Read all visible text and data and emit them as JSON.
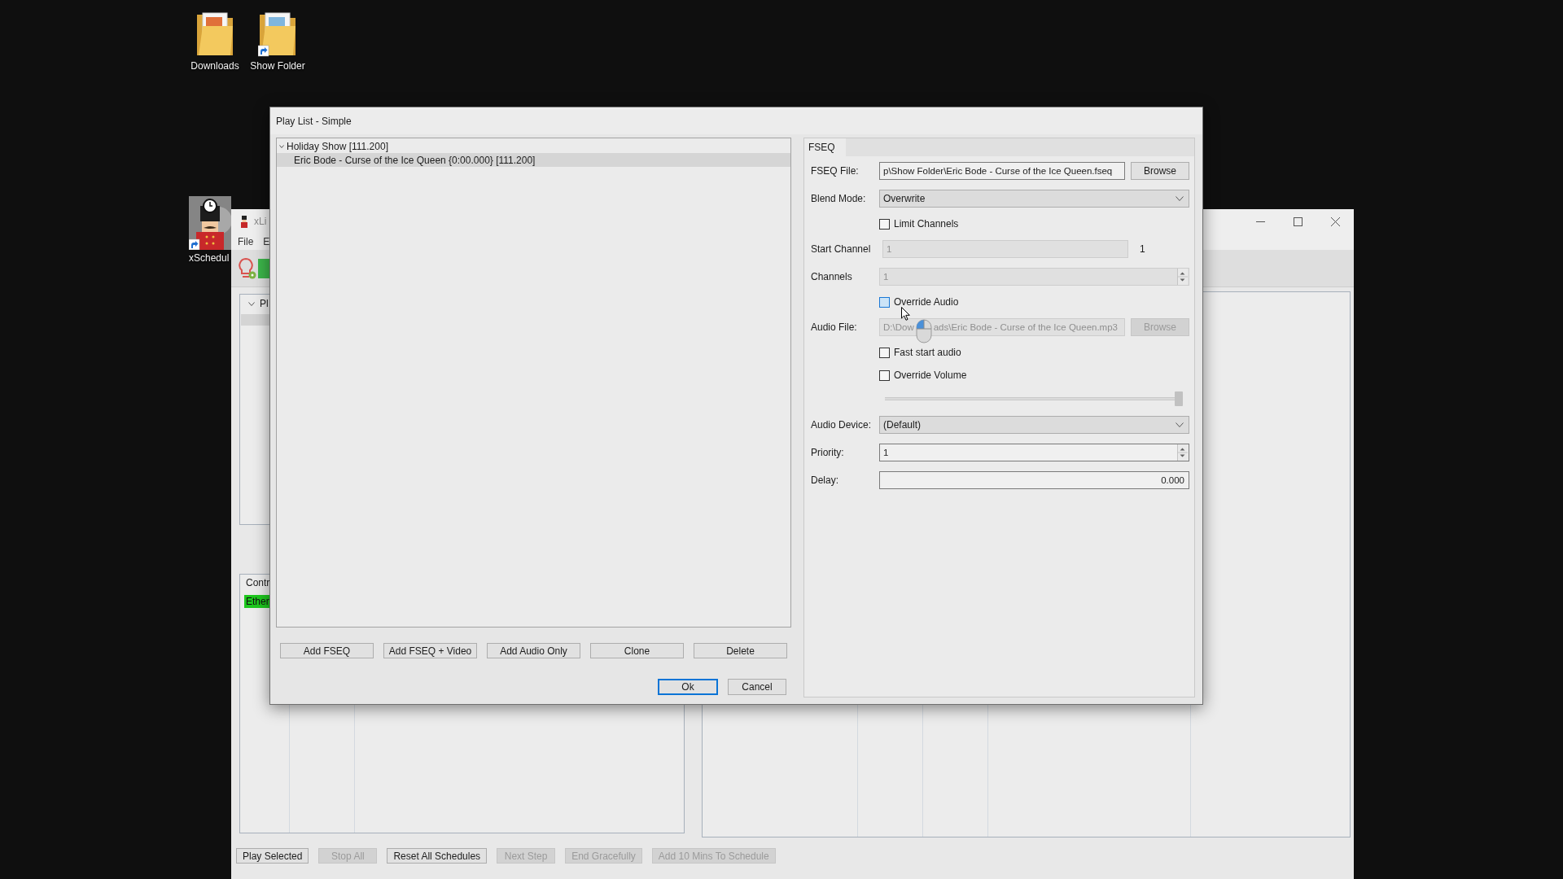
{
  "desktop_icons": [
    {
      "label": "Downloads",
      "kind": "folder",
      "shortcut": false
    },
    {
      "label": "Show Folder",
      "kind": "folder",
      "shortcut": true
    },
    {
      "label": "xSchedul",
      "kind": "app",
      "shortcut": true
    }
  ],
  "background_window": {
    "title": "xLi",
    "menu": [
      "File",
      "E"
    ],
    "playlists": [
      {
        "label": "Pl",
        "expanded": true,
        "children": [
          {
            "selected": true
          }
        ]
      }
    ],
    "controllers": {
      "columns": [
        "Contr"
      ],
      "rows": [
        {
          "name": "Ether",
          "color": "#1ec81e"
        }
      ]
    },
    "buttons": [
      {
        "label": "Play Selected",
        "disabled": false
      },
      {
        "label": "Stop All",
        "disabled": true
      },
      {
        "label": "Reset All Schedules",
        "disabled": false
      },
      {
        "label": "Next Step",
        "disabled": true
      },
      {
        "label": "End Gracefully",
        "disabled": true
      },
      {
        "label": "Add 10 Mins To Schedule",
        "disabled": true
      }
    ]
  },
  "dialog": {
    "title": "Play List - Simple",
    "tree": [
      {
        "label": "Holiday Show [111.200]",
        "expanded": true,
        "selected": false,
        "children": [
          {
            "label": "Eric Bode - Curse of the Ice Queen {0:00.000} [111.200]",
            "selected": true
          }
        ]
      }
    ],
    "list_buttons": [
      "Add FSEQ",
      "Add FSEQ + Video",
      "Add Audio Only",
      "Clone",
      "Delete"
    ],
    "ok_button": {
      "label": "Ok",
      "default": true
    },
    "cancel_button": "Cancel",
    "tabs": [
      {
        "label": "FSEQ",
        "selected": true
      }
    ],
    "form": [
      {
        "kind": "file",
        "label": "FSEQ File:",
        "value": "p\\Show Folder\\Eric Bode - Curse of the Ice Queen.fseq",
        "button": "Browse",
        "disabled": false
      },
      {
        "kind": "select",
        "label": "Blend Mode:",
        "value": "Overwrite"
      },
      {
        "kind": "checkbox",
        "label": "Limit Channels",
        "checked": false,
        "hovered": false
      },
      {
        "kind": "text",
        "label": "Start Channel",
        "value": "1",
        "suffix": "1",
        "disabled": true
      },
      {
        "kind": "spin",
        "label": "Channels",
        "value": "1",
        "disabled": true
      },
      {
        "kind": "checkbox",
        "label": "Override Audio",
        "checked": false,
        "hovered": true
      },
      {
        "kind": "file",
        "label": "Audio File:",
        "value_parts": [
          "D:\\Dow",
          "ads\\Eric Bode - Curse of the Ice Queen.mp3"
        ],
        "button": "Browse",
        "disabled": true
      },
      {
        "kind": "checkbox",
        "label": "Fast start audio",
        "checked": false,
        "hovered": false
      },
      {
        "kind": "checkbox",
        "label": "Override Volume",
        "checked": false,
        "hovered": false
      },
      {
        "kind": "slider",
        "level": 1,
        "disabled": true
      },
      {
        "kind": "select",
        "label": "Audio Device:",
        "value": "(Default)"
      },
      {
        "kind": "spin",
        "label": "Priority:",
        "value": "1",
        "disabled": false
      },
      {
        "kind": "number",
        "label": "Delay:",
        "value": "0.000"
      }
    ]
  }
}
